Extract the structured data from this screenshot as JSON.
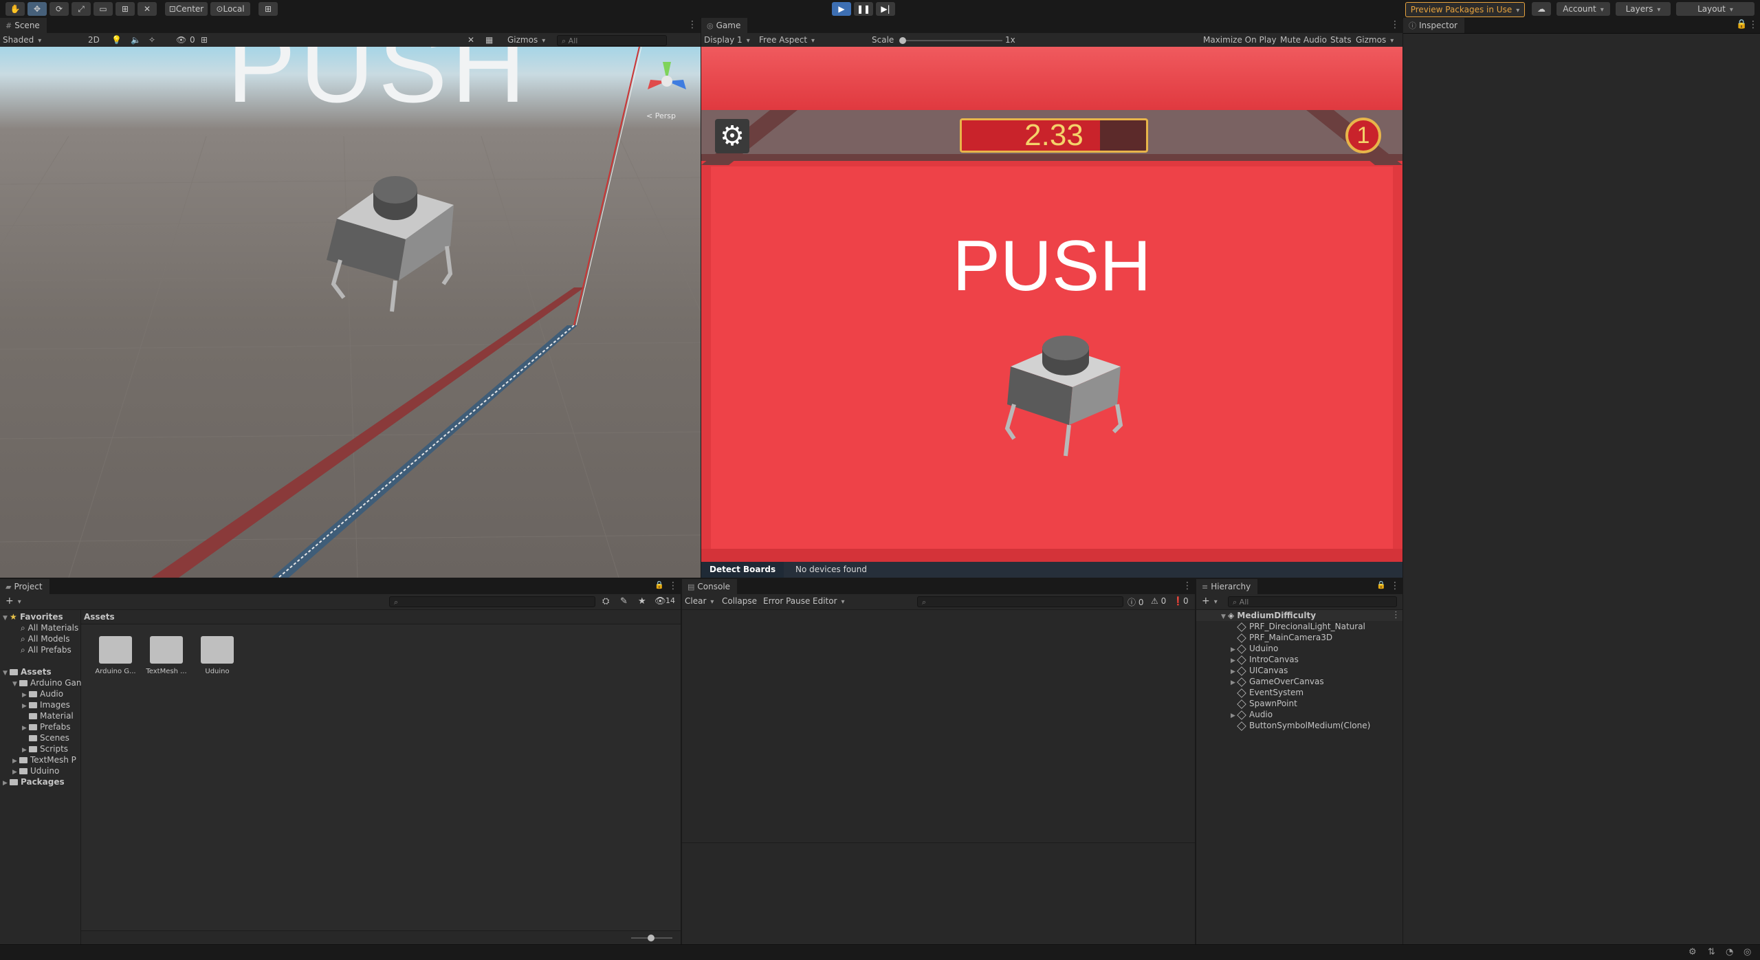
{
  "toolbar": {
    "transform_tools": [
      "hand-tool-icon",
      "move-tool-icon",
      "rotate-tool-icon",
      "scale-tool-icon",
      "rect-tool-icon",
      "transform-tool-icon",
      "custom-tool-icon"
    ],
    "pivot_label": "Center",
    "space_label": "Local",
    "play_controls": [
      "play-icon",
      "pause-icon",
      "step-icon"
    ],
    "preview_packages": "Preview Packages in Use",
    "account": "Account",
    "layers": "Layers",
    "layout": "Layout",
    "accent": "#e8a33d",
    "play_active": "#4a90e2"
  },
  "scene": {
    "tab": "Scene",
    "shading": "Shaded",
    "mode_2d": "2D",
    "hidden_count": "0",
    "gizmos": "Gizmos",
    "search_placeholder": "All",
    "persp_label": "< Persp",
    "background_text": "PUSH"
  },
  "game": {
    "tab": "Game",
    "display": "Display 1",
    "aspect": "Free Aspect",
    "scale_label": "Scale",
    "scale_value": "1x",
    "maximize": "Maximize On Play",
    "mute": "Mute Audio",
    "stats": "Stats",
    "gizmos": "Gizmos",
    "timer": "2.33",
    "timer_fill": 0.75,
    "push_label": "PUSH",
    "lives": "1",
    "bg_color": "#e0393f"
  },
  "detect": {
    "tab": "Detect Boards",
    "status": "No devices found"
  },
  "inspector": {
    "tab": "Inspector"
  },
  "project": {
    "tab": "Project",
    "add_label": "+",
    "hidden_count": "14",
    "favorites": {
      "label": "Favorites",
      "items": [
        "All Materials",
        "All Models",
        "All Prefabs"
      ]
    },
    "assets_root": "Assets",
    "tree": [
      {
        "label": "Arduino Gan",
        "level": 1,
        "expanded": true
      },
      {
        "label": "Audio",
        "level": 2
      },
      {
        "label": "Images",
        "level": 2
      },
      {
        "label": "Material",
        "level": 2
      },
      {
        "label": "Prefabs",
        "level": 2
      },
      {
        "label": "Scenes",
        "level": 2
      },
      {
        "label": "Scripts",
        "level": 2
      },
      {
        "label": "TextMesh P",
        "level": 1
      },
      {
        "label": "Uduino",
        "level": 1
      }
    ],
    "packages": "Packages",
    "breadcrumb": "Assets",
    "folders": [
      "Arduino G...",
      "TextMesh ...",
      "Uduino"
    ]
  },
  "console": {
    "tab": "Console",
    "clear": "Clear",
    "collapse": "Collapse",
    "error_pause": "Error Pause",
    "editor": "Editor",
    "counts": {
      "info": "0",
      "warn": "0",
      "error": "0"
    }
  },
  "hierarchy": {
    "tab": "Hierarchy",
    "add_label": "+",
    "search_placeholder": "All",
    "scene_name": "MediumDifficulty",
    "items": [
      {
        "label": "PRF_DirecionalLight_Natural",
        "expandable": false
      },
      {
        "label": "PRF_MainCamera3D",
        "expandable": false
      },
      {
        "label": "Uduino",
        "expandable": true
      },
      {
        "label": "IntroCanvas",
        "expandable": true
      },
      {
        "label": "UICanvas",
        "expandable": true
      },
      {
        "label": "GameOverCanvas",
        "expandable": true
      },
      {
        "label": "EventSystem",
        "expandable": false
      },
      {
        "label": "SpawnPoint",
        "expandable": false
      },
      {
        "label": "Audio",
        "expandable": true
      },
      {
        "label": "ButtonSymbolMedium(Clone)",
        "expandable": false
      }
    ]
  }
}
